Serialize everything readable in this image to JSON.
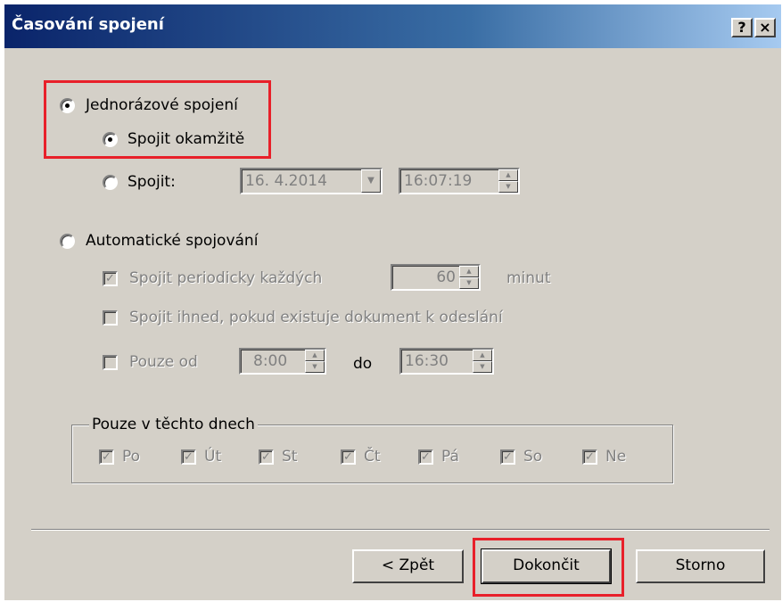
{
  "window": {
    "title": "Časování spojení",
    "help_button": "?",
    "close_button": "×"
  },
  "connection": {
    "one_time_label": "Jednorázové spojení",
    "connect_now_label": "Spojit okamžitě",
    "connect_at_label": "Spojit:",
    "date_value": "16.  4.2014",
    "time_value": "16:07:19"
  },
  "automatic": {
    "label": "Automatické spojování",
    "periodic_label": "Spojit periodicky každých",
    "periodic_value": "60",
    "periodic_unit": "minut",
    "immediate_label": "Spojit ihned, pokud existuje dokument k odeslání",
    "only_from_label": "Pouze od",
    "from_value": "8:00",
    "to_label": "do",
    "to_value": "16:30"
  },
  "days": {
    "group_label": "Pouze v těchto dnech",
    "items": [
      "Po",
      "Út",
      "St",
      "Čt",
      "Pá",
      "So",
      "Ne"
    ]
  },
  "buttons": {
    "back": "< Zpět",
    "finish": "Dokončit",
    "cancel": "Storno"
  },
  "colors": {
    "highlight": "#e8202a",
    "titlebar_start": "#0a246a",
    "titlebar_end": "#a6caf0",
    "face": "#d4d0c8"
  }
}
